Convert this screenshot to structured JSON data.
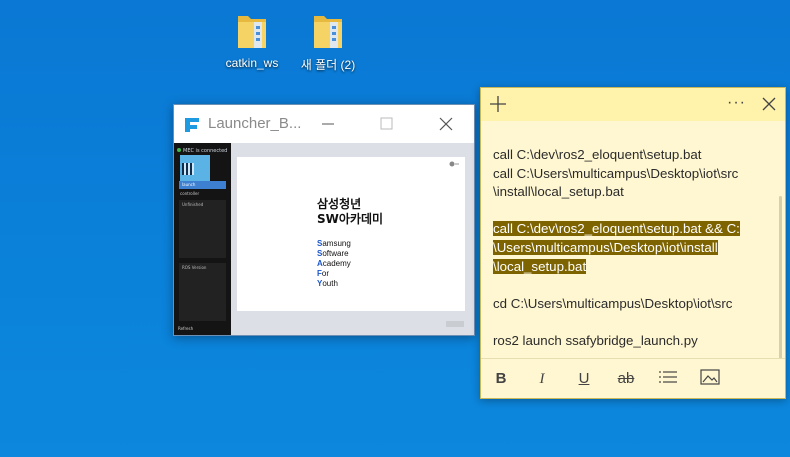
{
  "desktop": {
    "icons": [
      {
        "label": "catkin_ws"
      },
      {
        "label": "새 폴더 (2)"
      }
    ]
  },
  "launcher": {
    "title": "Launcher_B...",
    "sidebar": {
      "status": "MEC is connected",
      "button": "launch",
      "item": "controller",
      "panel1_header": "Unfinished",
      "panel2_header": "ROS Version",
      "footer": "Refresh"
    },
    "document": {
      "heading_line1": "삼성청년",
      "heading_line2": "SW아카데미",
      "list": [
        {
          "cap": "S",
          "rest": "amsung"
        },
        {
          "cap": "S",
          "rest": "oftware"
        },
        {
          "cap": "A",
          "rest": "cademy"
        },
        {
          "cap": "F",
          "rest": "or"
        },
        {
          "cap": "Y",
          "rest": "outh"
        }
      ]
    }
  },
  "note": {
    "lines": {
      "l1": "call C:\\dev\\ros2_eloquent\\setup.bat",
      "l2": "call  C:\\Users\\multicampus\\Desktop\\iot\\src",
      "l3": "\\install\\local_setup.bat",
      "h1": "call C:\\dev\\ros2_eloquent\\setup.bat && C:",
      "h2": "\\Users\\multicampus\\Desktop\\iot\\install",
      "h3": "\\local_setup.bat",
      "l4": "cd C:\\Users\\multicampus\\Desktop\\iot\\src",
      "l5": "ros2 launch ssafybridge_launch.py"
    },
    "menu_label": "···",
    "toolbar": {
      "bold": "B",
      "italic": "I",
      "underline": "U",
      "strike": "ab"
    },
    "colors": {
      "background": "#fff7d1",
      "header": "#fff2ab",
      "highlight": "#7e6400"
    }
  },
  "colors": {
    "desktop": "#0a78d4"
  }
}
